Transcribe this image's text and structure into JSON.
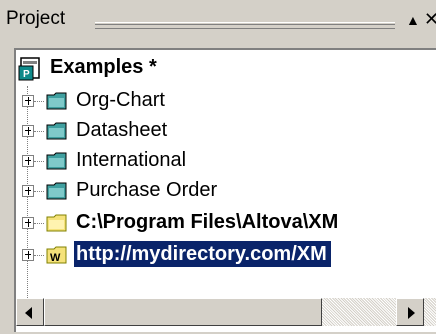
{
  "panel": {
    "title": "Project"
  },
  "tree": {
    "root": {
      "label": "Examples *",
      "icon": "project-icon"
    },
    "items": [
      {
        "label": "Org-Chart",
        "icon": "folder-teal-icon",
        "bold": false,
        "selected": false
      },
      {
        "label": "Datasheet",
        "icon": "folder-teal-icon",
        "bold": false,
        "selected": false
      },
      {
        "label": "International",
        "icon": "folder-teal-icon",
        "bold": false,
        "selected": false
      },
      {
        "label": "Purchase Order",
        "icon": "folder-teal-icon",
        "bold": false,
        "selected": false
      },
      {
        "label": "C:\\Program Files\\Altova\\XM",
        "icon": "folder-yellow-icon",
        "bold": true,
        "selected": false
      },
      {
        "label": "http://mydirectory.com/XM",
        "icon": "webdav-folder-icon",
        "bold": true,
        "selected": true
      }
    ]
  },
  "colors": {
    "selection": "#0a246a",
    "panel": "#d4d0c8",
    "folder_teal": "#3f9f9f",
    "folder_yellow": "#f5e27a"
  }
}
